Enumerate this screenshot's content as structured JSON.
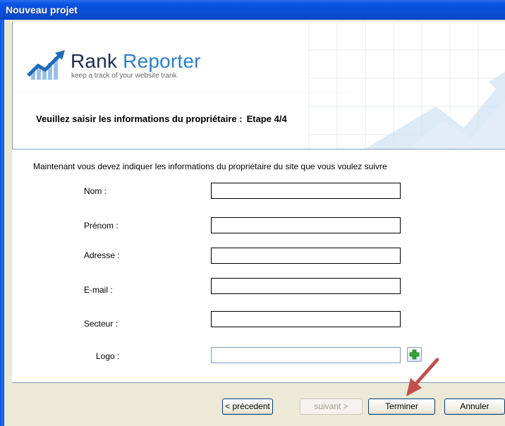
{
  "window": {
    "title": "Nouveau projet"
  },
  "header": {
    "brand_part1": "Rank",
    "brand_part2": "Reporter",
    "tagline": "keep a track of your website trank",
    "instruction": "Veuillez saisir les informations du propriétaire :",
    "step": "Etape 4/4"
  },
  "form": {
    "intro": "Maintenant vous devez indiquer les informations du propriétaire du site que vous voulez suivre",
    "fields": [
      {
        "label": "Nom :",
        "value": ""
      },
      {
        "label": "Prénom :",
        "value": ""
      },
      {
        "label": "Adresse :",
        "value": ""
      },
      {
        "label": "E-mail :",
        "value": ""
      },
      {
        "label": "Secteur :",
        "value": ""
      },
      {
        "label": "Logo :",
        "value": ""
      }
    ],
    "add_logo_icon": "plus-icon"
  },
  "buttons": {
    "previous": "< précedent",
    "next": "suivant >",
    "finish": "Terminer",
    "cancel": "Annuler"
  },
  "colors": {
    "titlebar": "#0a4fd6",
    "accent_blue": "#2d7fc8",
    "annotation_arrow": "#c0504d",
    "plus_green": "#3aa935"
  }
}
